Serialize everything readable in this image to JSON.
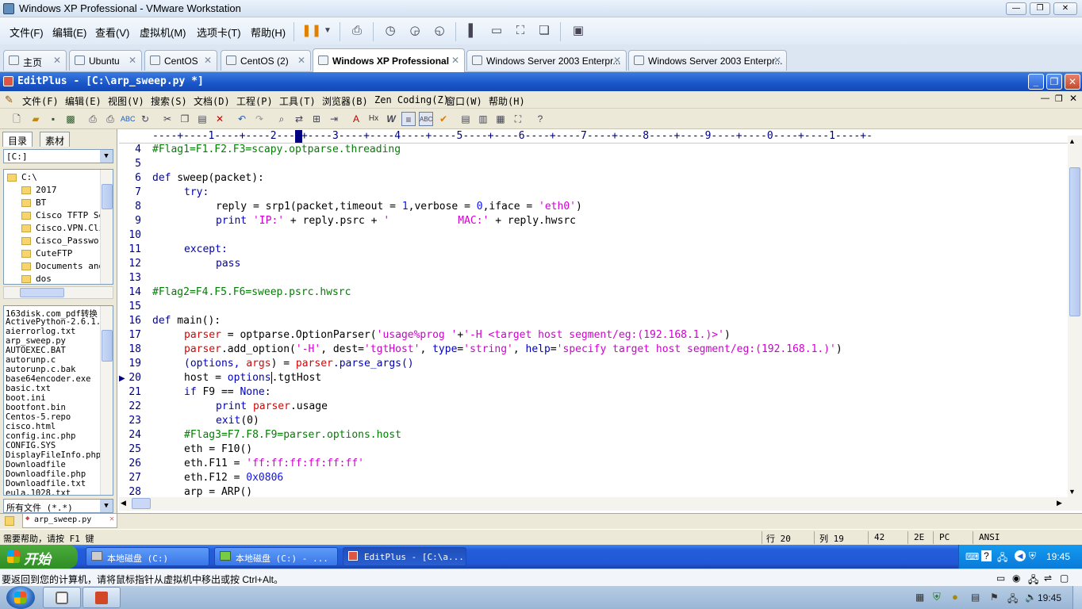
{
  "vmware": {
    "title": "Windows XP Professional - VMware Workstation",
    "menu": [
      "文件(F)",
      "编辑(E)",
      "查看(V)",
      "虚拟机(M)",
      "选项卡(T)",
      "帮助(H)"
    ],
    "tabs": [
      {
        "label": "主页"
      },
      {
        "label": "Ubuntu"
      },
      {
        "label": "CentOS"
      },
      {
        "label": "CentOS (2)"
      },
      {
        "label": "Windows XP Professional"
      },
      {
        "label": "Windows Server 2003 Enterpr..."
      },
      {
        "label": "Windows Server 2003 Enterpr..."
      }
    ],
    "status_hint": "要返回到您的计算机，请将鼠标指针从虚拟机中移出或按 Ctrl+Alt。"
  },
  "editplus": {
    "title": "EditPlus - [C:\\arp_sweep.py *]",
    "menu": [
      "文件(F)",
      "编辑(E)",
      "视图(V)",
      "搜索(S)",
      "文档(D)",
      "工程(P)",
      "工具(T)",
      "浏览器(B)",
      "Zen Coding(Z)",
      "窗口(W)",
      "帮助(H)"
    ],
    "left_tabs": [
      "目录",
      "素材"
    ],
    "drive": "[C:]",
    "dirs": [
      "C:\\",
      "2017",
      "BT",
      "Cisco TFTP Se",
      "Cisco.VPN.Cli",
      "Cisco_Passwor",
      "CuteFTP",
      "Documents and",
      "dos"
    ],
    "files": [
      "163disk.com_pdf转换",
      "ActivePython-2.6.1.1",
      "aierrorlog.txt",
      "arp_sweep.py",
      "AUTOEXEC.BAT",
      "autorunp.c",
      "autorunp.c.bak",
      "base64encoder.exe",
      "basic.txt",
      "boot.ini",
      "bootfont.bin",
      "Centos-5.repo",
      "cisco.html",
      "config.inc.php",
      "CONFIG.SYS",
      "DisplayFileInfo.php",
      "Downloadfile",
      "Downloadfile.php",
      "Downloadfile.txt",
      "eula.1028.txt"
    ],
    "filter": "所有文件 (*.*)",
    "ruler": "----+----1----+----2----+----3----+----4----+----5----+----6----+----7----+----8----+----9----+----0----+----1----+-",
    "line_numbers": [
      "4",
      "5",
      "6",
      "7",
      "8",
      "9",
      "10",
      "11",
      "12",
      "13",
      "14",
      "15",
      "16",
      "17",
      "18",
      "19",
      "20",
      "21",
      "22",
      "23",
      "24",
      "25",
      "26",
      "27",
      "28"
    ],
    "doc_tab": "arp_sweep.py",
    "status": {
      "help": "需要帮助，请按 F1 键",
      "line": "行 20",
      "col": "列 19",
      "total": "42",
      "hex": "2E",
      "mode": "PC",
      "encoding": "ANSI"
    }
  },
  "code": {
    "l4": "#Flag1=F1.F2.F3=scapy.optparse.threading",
    "l6_def": "def",
    "l6_rest": " sweep(packet):",
    "l7": "try:",
    "l8a": "reply = srp1(packet,timeout = ",
    "l8b": "1",
    "l8c": ",verbose = ",
    "l8d": "0",
    "l8e": ",iface = ",
    "l8f": "'eth0'",
    "l8g": ")",
    "l9a": "print",
    "l9b": " ",
    "l9c": "'IP:'",
    "l9d": " + reply.psrc + ",
    "l9e": "'           MAC:'",
    "l9f": " + reply.hwsrc",
    "l11": "except:",
    "l12": "pass",
    "l14": "#Flag2=F4.F5.F6=sweep.psrc.hwsrc",
    "l16_def": "def",
    "l16_rest": " main():",
    "l17a": "parser",
    "l17b": " = optparse.OptionParser(",
    "l17c": "'usage%prog '",
    "l17d": "+",
    "l17e": "'-H <target host segment/eg:(192.168.1.)>'",
    "l17f": ")",
    "l18a": "parser",
    "l18b": ".add_option(",
    "l18c": "'-H'",
    "l18d": ", dest=",
    "l18e": "'tgtHost'",
    "l18f": ", ",
    "l18g": "type",
    "l18h": "=",
    "l18i": "'string'",
    "l18j": ", ",
    "l18k": "help",
    "l18l": "=",
    "l18m": "'specify target host segment/eg:(192.168.1.)'",
    "l18n": ")",
    "l19a": "(options, ",
    "l19b": "args",
    "l19c": ") = ",
    "l19d": "parser",
    "l19e": ".parse_args()",
    "l20a": "host = ",
    "l20b": "options",
    "l20c": ".tgtHost",
    "l21a": "if",
    "l21b": " F9 == ",
    "l21c": "None",
    "l21d": ":",
    "l22a": "print",
    "l22b": " ",
    "l22c": "parser",
    "l22d": ".usage",
    "l23a": "exit",
    "l23b": "(0)",
    "l24": "#Flag3=F7.F8.F9=parser.options.host",
    "l25": "eth = F10()",
    "l26a": "eth.F11 = ",
    "l26b": "'ff:ff:ff:ff:ff:ff'",
    "l27a": "eth.F12 = ",
    "l27b": "0x0806",
    "l28": "arp = ARP()"
  },
  "xp_taskbar": {
    "start": "开始",
    "items": [
      "本地磁盘 (C:)",
      "本地磁盘 (C:) - ...",
      "EditPlus - [C:\\a..."
    ],
    "clock": "19:45"
  },
  "host_taskbar": {
    "clock": "19:45"
  },
  "colors": {
    "keyword": "#0000c0",
    "comment": "#008000",
    "string": "#d000d0",
    "identifier": "#e00000",
    "xp_blue": "#245edb"
  }
}
